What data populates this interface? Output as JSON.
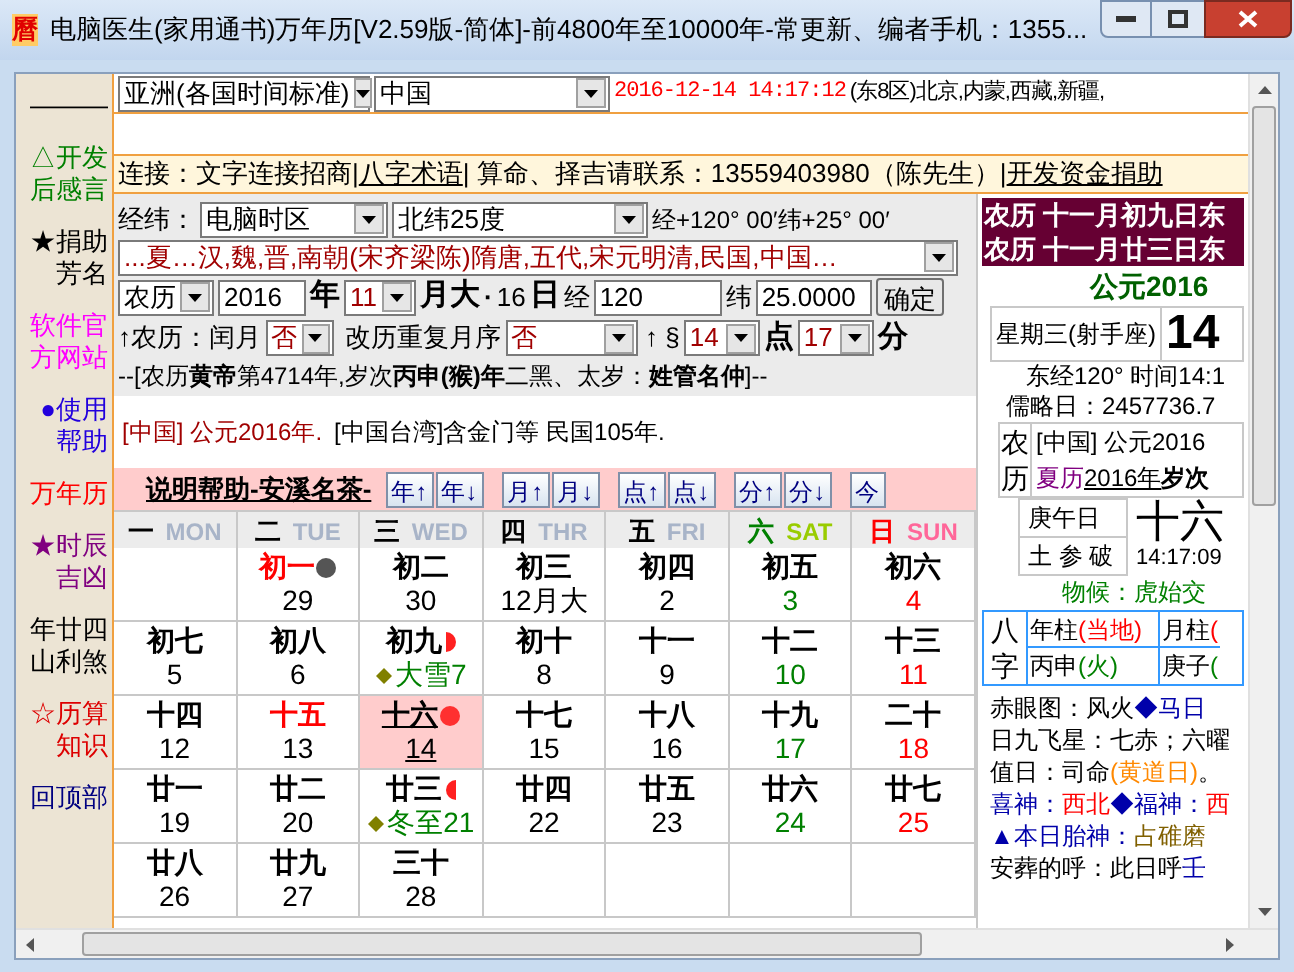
{
  "window": {
    "title": "电脑医生(家用通书)万年历[V2.59版-简体]-前4800年至10000年-常更新、编者手机：1355...",
    "icon_text": "曆"
  },
  "sidebar": {
    "items": [
      {
        "label": "———",
        "color": "#000000"
      },
      {
        "label": "△开发后感言",
        "color": "#008000"
      },
      {
        "label": "★捐助芳名",
        "color": "#000000"
      },
      {
        "label": "软件官方网站",
        "color": "#ff00ff"
      },
      {
        "label": "●使用帮助",
        "color": "#2200dd"
      },
      {
        "label": "万年历",
        "color": "#ff0000"
      },
      {
        "label": "★时辰吉凶",
        "color": "#800080"
      },
      {
        "label": "年廿四山利煞",
        "color": "#000000"
      },
      {
        "label": "☆历算知识",
        "color": "#dd0000"
      },
      {
        "label": "回顶部",
        "color": "#000080"
      }
    ]
  },
  "location": {
    "region": "亚洲(各国时间标准)",
    "country": "中国",
    "datetime": "2016-12-14 14:17:12",
    "zone": "(东8区)北京,内蒙,西藏,新疆,"
  },
  "links": [
    {
      "text": "连接：文字连接招商|",
      "kind": "text"
    },
    {
      "text": "八字术语",
      "kind": "link"
    },
    {
      "text": "| 算命、择吉请联系：13559403980（陈先生）|",
      "kind": "text"
    },
    {
      "text": "开发资金捐助",
      "kind": "link"
    }
  ],
  "coords": {
    "label": "经纬：",
    "zone": "电脑时区",
    "latitude_choice": "北纬25度",
    "reading": "经+120° 00′纬+25° 00′"
  },
  "era": "...夏…汉,魏,晋,南朝(宋齐梁陈)隋唐,五代,宋元明清,民国,中国…",
  "date_row": {
    "calendar": "农历",
    "year": "2016",
    "year_label": "年",
    "month": "11",
    "month_label": "月大",
    "dot": "·",
    "day": "16",
    "day_label": "日",
    "lon_label": "经",
    "lon": "120",
    "lat_label": "纬",
    "lat": "25.0000",
    "ok": "确定"
  },
  "leap_row": {
    "leap_label": "↑农历：闰月",
    "leap": "否",
    "repeat_label": "改历重复月序",
    "repeat": "否",
    "time_label": "↑ §",
    "hour": "14",
    "hour_label": "点",
    "minute": "17",
    "minute_label": "分"
  },
  "summary": "--[农历**黄帝**第4714年,岁次**丙申(猴)年**二黑、太岁：**姓管名仲**]--",
  "notes": {
    "china": "[中国] 公元2016年.",
    "taiwan": "[中国台湾]含金门等 民国105年."
  },
  "toolbar": {
    "title": "说明帮助-安溪名茶-",
    "buttons": [
      "年↑",
      "年↓",
      "月↑",
      "月↓",
      "点↑",
      "点↓",
      "分↑",
      "分↓",
      "今"
    ]
  },
  "weekdays": [
    {
      "cn": "一",
      "en": "MON",
      "kind": "weekday"
    },
    {
      "cn": "二",
      "en": "TUE",
      "kind": "weekday"
    },
    {
      "cn": "三",
      "en": "WED",
      "kind": "weekday"
    },
    {
      "cn": "四",
      "en": "THR",
      "kind": "weekday"
    },
    {
      "cn": "五",
      "en": "FRI",
      "kind": "weekday"
    },
    {
      "cn": "六",
      "en": "SAT",
      "kind": "saturday"
    },
    {
      "cn": "日",
      "en": "SUN",
      "kind": "sunday"
    }
  ],
  "weeks": [
    [
      {
        "lunar": "初一",
        "day": "29",
        "red": true,
        "kind": "new_moon",
        "selected": false
      },
      {
        "lunar": "初二",
        "day": "30",
        "red": false,
        "selected": false
      },
      {
        "lunar": "初三",
        "day": "12月大",
        "red": false,
        "selected": false
      },
      {
        "lunar": "初四",
        "day": "2",
        "red": false,
        "selected": false
      },
      {
        "lunar": "初五",
        "day": "3",
        "red": false,
        "selected": false
      },
      {
        "lunar": "初六",
        "day": "4",
        "red": false,
        "selected": false
      }
    ],
    [
      {
        "lunar": "初七",
        "day": "5",
        "red": false,
        "selected": false
      },
      {
        "lunar": "初八",
        "day": "6",
        "red": false,
        "selected": false
      },
      {
        "lunar": "初九",
        "day": "7",
        "term": "大雪",
        "red": false,
        "kind": "first_quarter",
        "selected": false
      },
      {
        "lunar": "初十",
        "day": "8",
        "red": false,
        "selected": false
      },
      {
        "lunar": "十一",
        "day": "9",
        "red": false,
        "selected": false
      },
      {
        "lunar": "十二",
        "day": "10",
        "red": false,
        "selected": false
      },
      {
        "lunar": "十三",
        "day": "11",
        "red": false,
        "selected": false
      }
    ],
    [
      {
        "lunar": "十四",
        "day": "12",
        "red": false,
        "selected": false
      },
      {
        "lunar": "十五",
        "day": "13",
        "red": true,
        "selected": false
      },
      {
        "lunar": "十六",
        "day": "14",
        "red": false,
        "kind": "full_moon",
        "selected": true
      },
      {
        "lunar": "十七",
        "day": "15",
        "red": false,
        "selected": false
      },
      {
        "lunar": "十八",
        "day": "16",
        "red": false,
        "selected": false
      },
      {
        "lunar": "十九",
        "day": "17",
        "red": false,
        "selected": false
      },
      {
        "lunar": "二十",
        "day": "18",
        "red": false,
        "selected": false
      }
    ],
    [
      {
        "lunar": "廿一",
        "day": "19",
        "red": false,
        "selected": false
      },
      {
        "lunar": "廿二",
        "day": "20",
        "red": false,
        "selected": false
      },
      {
        "lunar": "廿三",
        "day": "21",
        "term": "冬至",
        "red": false,
        "kind": "last_quarter",
        "selected": false
      },
      {
        "lunar": "廿四",
        "day": "22",
        "red": false,
        "selected": false
      },
      {
        "lunar": "廿五",
        "day": "23",
        "red": false,
        "selected": false
      },
      {
        "lunar": "廿六",
        "day": "24",
        "red": false,
        "selected": false
      },
      {
        "lunar": "廿七",
        "day": "25",
        "red": false,
        "selected": false
      }
    ],
    [
      {
        "lunar": "廿八",
        "day": "26",
        "red": false,
        "selected": false
      },
      {
        "lunar": "廿九",
        "day": "27",
        "red": false,
        "selected": false
      },
      {
        "lunar": "三十",
        "day": "28",
        "red": false,
        "selected": false
      }
    ]
  ],
  "right": {
    "banner": [
      "农历 十一月初九日东",
      "农历 十一月廿三日东"
    ],
    "year": "公元2016",
    "weekday": "星期三(射手座)",
    "day_big": "14",
    "lon_time": "东经120° 时间14:1",
    "julian": "儒略日：2457736.7",
    "side_label": "农历",
    "china_line": "[中国] 公元2016",
    "xia": {
      "era": "夏历",
      "year": "2016年",
      "rest": "岁次"
    },
    "ganzhi_day": "庚午日",
    "stars": "土 参 破",
    "lunar_big": "十六",
    "time": "14:17:09",
    "phenology": "物候：虎始交",
    "bazi": {
      "label": "八字",
      "pillars": [
        {
          "name": "年柱",
          "note": "(当地)"
        },
        {
          "name": "月柱",
          "note": "("
        }
      ],
      "values": [
        {
          "name": "丙申",
          "note": "(火)"
        },
        {
          "name": "庚子",
          "note": "("
        }
      ]
    },
    "lines": [
      [
        {
          "text": "赤眼图：风火 "
        },
        {
          "text": "◆马日",
          "color": "#0000aa"
        }
      ],
      [
        {
          "text": "日九飞星：七赤；六曜"
        }
      ],
      [
        {
          "text": "值日：司命"
        },
        {
          "text": "(黄道日)",
          "color": "#ff8800"
        },
        {
          "text": "。"
        }
      ],
      [
        {
          "text": "喜神：",
          "color": "#0000aa"
        },
        {
          "text": "西北",
          "color": "#ff0000"
        },
        {
          "text": "◆福神：",
          "color": "#0000aa"
        },
        {
          "text": "西",
          "color": "#ff0000"
        }
      ],
      [
        {
          "text": "▲本日胎神：",
          "color": "#0000aa"
        },
        {
          "text": "占碓磨",
          "color": "#806000"
        }
      ],
      [
        {
          "text": "安葬的呼：此日呼"
        },
        {
          "text": "壬",
          "color": "#0000aa"
        }
      ]
    ]
  }
}
